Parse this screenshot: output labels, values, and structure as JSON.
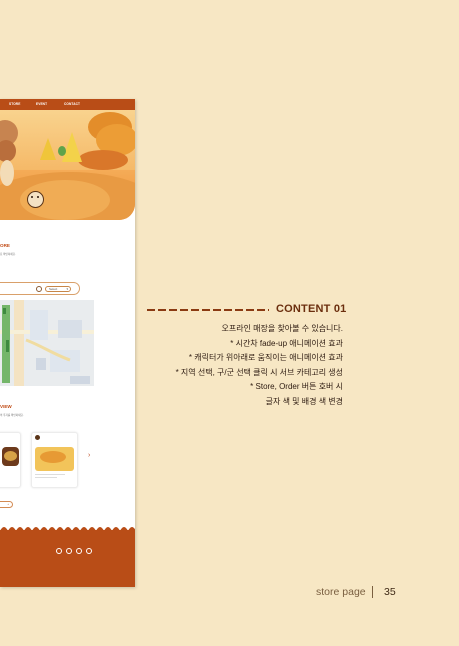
{
  "mockup": {
    "nav": {
      "items": [
        "STORE",
        "EVENT",
        "CONTACT"
      ]
    },
    "store_section": {
      "title": "ORE",
      "subtitle": "요 확인하세요."
    },
    "search": {
      "select_label": "Select"
    },
    "review_section": {
      "title": "VIEW",
      "subtitle": "의 후기를 확인하세요."
    },
    "more_button": {
      "label": "+"
    },
    "next_arrow": "›",
    "footer": {
      "sns_icons": [
        "instagram-icon",
        "youtube-icon",
        "facebook-icon",
        "x-icon"
      ]
    }
  },
  "annotation": {
    "title": "CONTENT 01",
    "lines": [
      "오프라인 매장을 찾아볼 수 있습니다.",
      "* 시간차 fade-up 애니메이션 효과",
      "* 캐릭터가 위아래로 움직이는 애니메이션 효과",
      "* 지역 선택, 구/군 선택 클릭 시 서브 카테고리 생성",
      "* Store, Order 버튼 호버 시",
      "글자 색 및 배경 색 변경"
    ]
  },
  "page_footer": {
    "label": "store page",
    "separator": "|",
    "page_number": "35"
  },
  "colors": {
    "background": "#f7e7c4",
    "brand": "#b94d17",
    "title": "#6b2e0e"
  }
}
